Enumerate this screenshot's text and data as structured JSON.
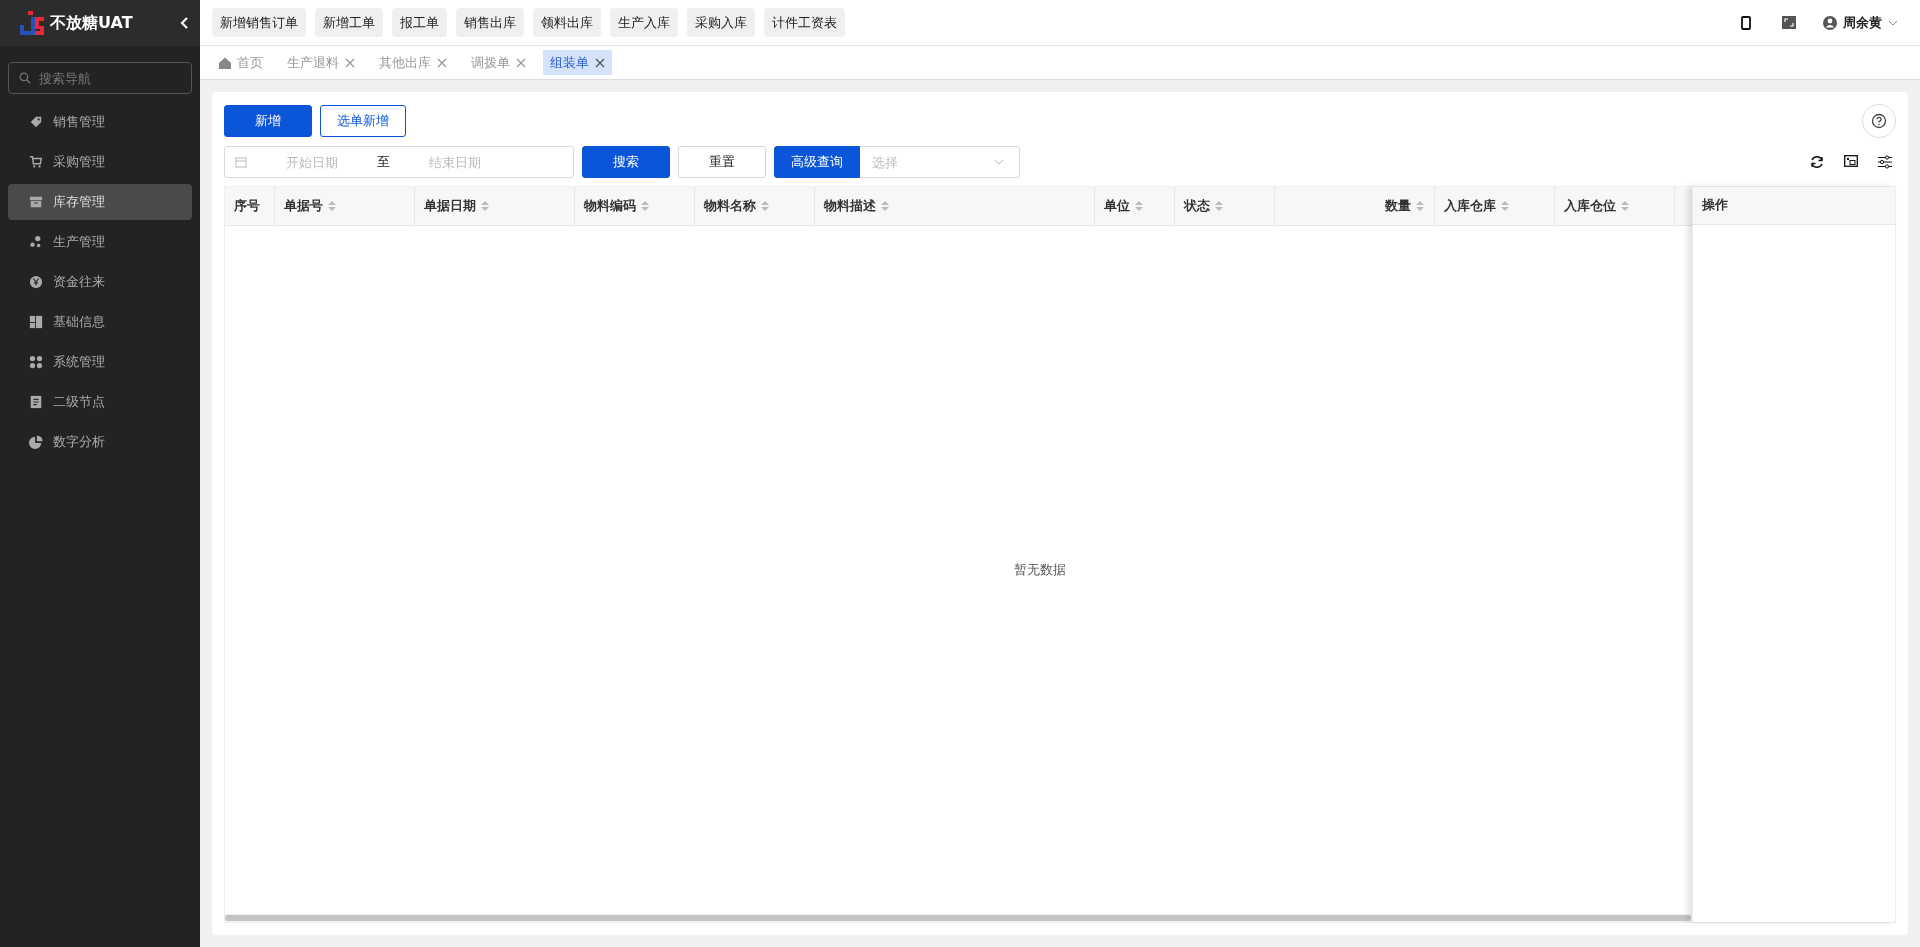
{
  "brand": {
    "title": "不放糖UAT"
  },
  "sidebar": {
    "search": {
      "placeholder": "搜索导航"
    },
    "items": [
      {
        "label": "销售管理",
        "selected": false
      },
      {
        "label": "采购管理",
        "selected": false
      },
      {
        "label": "库存管理",
        "selected": true
      },
      {
        "label": "生产管理",
        "selected": false
      },
      {
        "label": "资金往来",
        "selected": false
      },
      {
        "label": "基础信息",
        "selected": false
      },
      {
        "label": "系统管理",
        "selected": false
      },
      {
        "label": "二级节点",
        "selected": false
      },
      {
        "label": "数字分析",
        "selected": false
      }
    ]
  },
  "shortcuts": [
    "新增销售订单",
    "新增工单",
    "报工单",
    "销售出库",
    "领料出库",
    "生产入库",
    "采购入库",
    "计件工资表"
  ],
  "user": {
    "name": "周余黄"
  },
  "tabs": [
    {
      "label": "首页",
      "kind": "home",
      "selected": false
    },
    {
      "label": "生产退料",
      "kind": "closable",
      "selected": false
    },
    {
      "label": "其他出库",
      "kind": "closable",
      "selected": false
    },
    {
      "label": "调拨单",
      "kind": "closable",
      "selected": false
    },
    {
      "label": "组装单",
      "kind": "closable",
      "selected": true
    }
  ],
  "actions": {
    "primary": "新增",
    "secondary": "选单新增"
  },
  "filters": {
    "start_placeholder": "开始日期",
    "separator": "至",
    "end_placeholder": "结束日期",
    "search": "搜索",
    "reset": "重置",
    "advanced": "高级查询",
    "select_placeholder": "选择"
  },
  "table": {
    "columns": [
      {
        "label": "序号",
        "sortable": false
      },
      {
        "label": "单据号",
        "sortable": true
      },
      {
        "label": "单据日期",
        "sortable": true
      },
      {
        "label": "物料编码",
        "sortable": true
      },
      {
        "label": "物料名称",
        "sortable": true
      },
      {
        "label": "物料描述",
        "sortable": true
      },
      {
        "label": "单位",
        "sortable": true
      },
      {
        "label": "状态",
        "sortable": true
      },
      {
        "label": "数量",
        "sortable": true
      },
      {
        "label": "入库仓库",
        "sortable": true
      },
      {
        "label": "入库仓位",
        "sortable": true
      }
    ],
    "fixed_column": "操作",
    "empty_text": "暂无数据"
  }
}
